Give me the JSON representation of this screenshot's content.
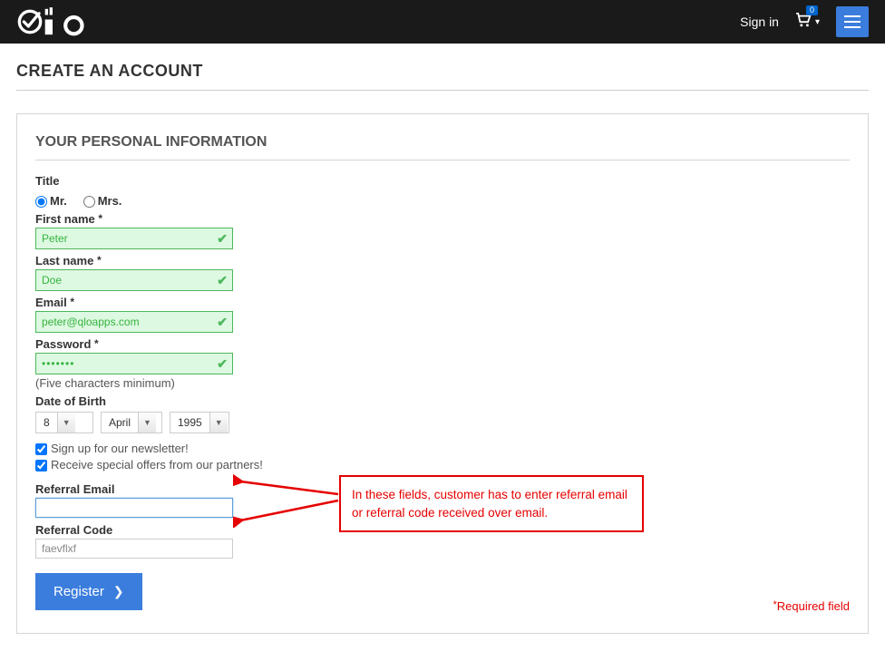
{
  "header": {
    "signin": "Sign in",
    "cart_count": "0"
  },
  "page": {
    "title": "CREATE AN ACCOUNT"
  },
  "panel": {
    "heading": "YOUR PERSONAL INFORMATION"
  },
  "form": {
    "title_label": "Title",
    "mr_label": "Mr.",
    "mrs_label": "Mrs.",
    "firstname_label": "First name",
    "firstname_value": "Peter",
    "lastname_label": "Last name",
    "lastname_value": "Doe",
    "email_label": "Email",
    "email_value": "peter@qloapps.com",
    "password_label": "Password",
    "password_value": "•••••••",
    "password_hint": "(Five characters minimum)",
    "dob_label": "Date of Birth",
    "dob_day": "8",
    "dob_month": "April",
    "dob_year": "1995",
    "newsletter_label": "Sign up for our newsletter!",
    "offers_label": "Receive special offers from our partners!",
    "referral_email_label": "Referral Email",
    "referral_email_value": "",
    "referral_code_label": "Referral Code",
    "referral_code_value": "faevflxf",
    "register_label": "Register"
  },
  "callout": {
    "text": "In these fields, customer has to enter referral email or referral code received over email."
  },
  "required": {
    "text": "Required field"
  }
}
